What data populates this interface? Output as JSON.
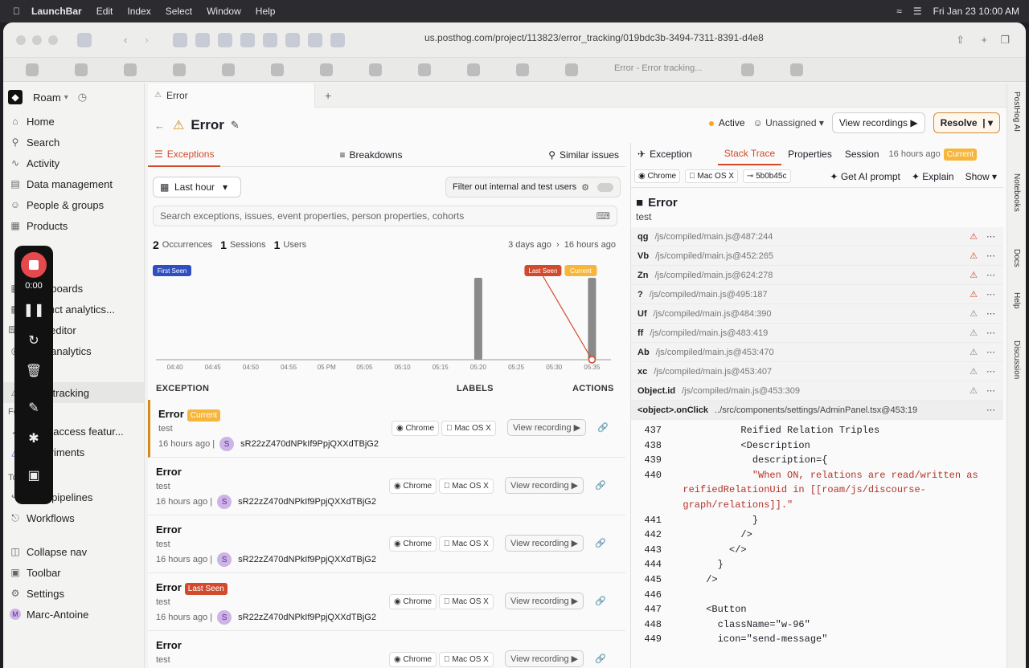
{
  "menubar": {
    "app": "LaunchBar",
    "items": [
      "Edit",
      "Index",
      "Select",
      "Window",
      "Help"
    ],
    "clock": "Fri Jan 23  10:00 AM"
  },
  "browser": {
    "url": "us.posthog.com/project/113823/error_tracking/019bdc3b-3494-7311-8391-d4e8",
    "bookmark_tab": "Error - Error tracking..."
  },
  "sidebar": {
    "project": "Roam",
    "items": [
      "Home",
      "Search",
      "Activity",
      "Data management",
      "People & groups",
      "Products",
      "Dashboards",
      "Product analytics...",
      "SQL editor",
      "Web analytics",
      "Error tracking"
    ],
    "features_label": "Features",
    "features": [
      "Early access featur...",
      "Experiments"
    ],
    "tools_label": "Tools",
    "tools": [
      "Data pipelines",
      "Workflows"
    ],
    "bottom": [
      "Collapse nav",
      "Toolbar",
      "Settings",
      "Marc-Antoine"
    ]
  },
  "recorder": {
    "time": "0:00"
  },
  "tabbar": {
    "tab_label": "Error"
  },
  "header": {
    "title": "Error",
    "status": "Active",
    "assignee": "Unassigned",
    "view_recordings": "View recordings",
    "resolve": "Resolve"
  },
  "subtabs": [
    "Exceptions",
    "Breakdowns",
    "Similar issues"
  ],
  "filters": {
    "date": "Last hour",
    "internal_toggle": "Filter out internal and test users",
    "search_placeholder": "Search exceptions, issues, event properties, person properties, cohorts"
  },
  "stats": {
    "occurrences": "2",
    "occurrences_label": "Occurrences",
    "sessions": "1",
    "sessions_label": "Sessions",
    "users": "1",
    "users_label": "Users",
    "from": "3 days ago",
    "to": "16 hours ago"
  },
  "chart_data": {
    "type": "bar",
    "categories": [
      "04:40",
      "04:45",
      "04:50",
      "04:55",
      "05 PM",
      "05:05",
      "05:10",
      "05:15",
      "05:20",
      "05:25",
      "05:30",
      "05:35"
    ],
    "values": [
      0,
      0,
      0,
      0,
      0,
      0,
      0,
      0,
      1,
      0,
      0,
      1
    ],
    "labels": {
      "first": "First Seen",
      "last": "Last Seen",
      "current": "Current"
    }
  },
  "list_headers": {
    "exception": "EXCEPTION",
    "labels": "LABELS",
    "actions": "ACTIONS"
  },
  "exceptions": [
    {
      "title": "Error",
      "badge": "Current",
      "sub": "test",
      "time": "16 hours ago",
      "avatar": "S",
      "id": "sR22zZ470dNPkIf9PpjQXXdTBjG2",
      "browser": "Chrome",
      "os": "Mac OS X",
      "action": "View recording"
    },
    {
      "title": "Error",
      "badge": "",
      "sub": "test",
      "time": "16 hours ago",
      "avatar": "S",
      "id": "sR22zZ470dNPkIf9PpjQXXdTBjG2",
      "browser": "Chrome",
      "os": "Mac OS X",
      "action": "View recording"
    },
    {
      "title": "Error",
      "badge": "",
      "sub": "test",
      "time": "16 hours ago",
      "avatar": "S",
      "id": "sR22zZ470dNPkIf9PpjQXXdTBjG2",
      "browser": "Chrome",
      "os": "Mac OS X",
      "action": "View recording"
    },
    {
      "title": "Error",
      "badge": "Last Seen",
      "sub": "test",
      "time": "16 hours ago",
      "avatar": "S",
      "id": "sR22zZ470dNPkIf9PpjQXXdTBjG2",
      "browser": "Chrome",
      "os": "Mac OS X",
      "action": "View recording"
    },
    {
      "title": "Error",
      "badge": "",
      "sub": "test",
      "time": "",
      "avatar": "",
      "id": "",
      "browser": "Chrome",
      "os": "Mac OS X",
      "action": "View recording"
    }
  ],
  "right_tabs": {
    "exception": "Exception",
    "tabs": [
      "Stack Trace",
      "Properties",
      "Session"
    ],
    "time": "16 hours ago",
    "badge": "Current"
  },
  "meta": {
    "browser": "Chrome",
    "os": "Mac OS X",
    "hash": "5b0b45c",
    "ai": "Get AI prompt",
    "explain": "Explain",
    "show": "Show"
  },
  "error": {
    "title": "Error",
    "subtitle": "test"
  },
  "frames": [
    {
      "fn": "qg",
      "path": "/js/compiled/main.js@487:244"
    },
    {
      "fn": "Vb",
      "path": "/js/compiled/main.js@452:265"
    },
    {
      "fn": "Zn",
      "path": "/js/compiled/main.js@624:278"
    },
    {
      "fn": "?",
      "path": "/js/compiled/main.js@495:187"
    },
    {
      "fn": "Uf",
      "path": "/js/compiled/main.js@484:390"
    },
    {
      "fn": "ff",
      "path": "/js/compiled/main.js@483:419"
    },
    {
      "fn": "Ab",
      "path": "/js/compiled/main.js@453:470"
    },
    {
      "fn": "xc",
      "path": "/js/compiled/main.js@453:407"
    },
    {
      "fn": "Object.id",
      "path": "/js/compiled/main.js@453:309"
    },
    {
      "fn": "<object>.onClick",
      "path": "../src/components/settings/AdminPanel.tsx@453:19"
    }
  ],
  "code": [
    {
      "n": "437",
      "t": "            Reified Relation Triples"
    },
    {
      "n": "438",
      "t": "            <Description"
    },
    {
      "n": "439",
      "t": "              description={"
    },
    {
      "n": "440",
      "t": "              \"When ON, relations are read/written as"
    },
    {
      "n": "",
      "t": "  reifiedRelationUid in [[roam/js/discourse-"
    },
    {
      "n": "",
      "t": "  graph/relations]].\""
    },
    {
      "n": "441",
      "t": "              }"
    },
    {
      "n": "442",
      "t": "            />"
    },
    {
      "n": "443",
      "t": "          </>"
    },
    {
      "n": "444",
      "t": "        }"
    },
    {
      "n": "445",
      "t": "      />"
    },
    {
      "n": "446",
      "t": ""
    },
    {
      "n": "447",
      "t": "      <Button"
    },
    {
      "n": "448",
      "t": "        className=\"w-96\""
    },
    {
      "n": "449",
      "t": "        icon=\"send-message\""
    }
  ],
  "rightbar": [
    "PostHog AI",
    "Notebooks",
    "Docs",
    "Help",
    "Discussion"
  ]
}
